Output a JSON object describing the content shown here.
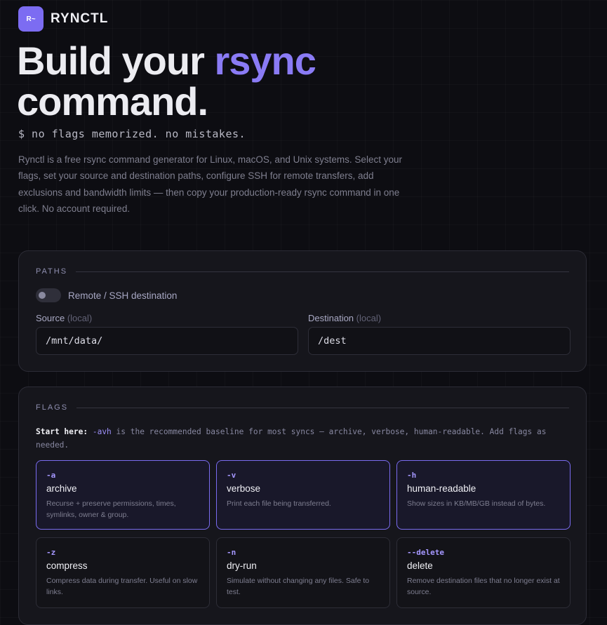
{
  "brand": {
    "logo_text": "R~",
    "name": "RYNCTL"
  },
  "hero": {
    "title_part1": "Build your ",
    "title_accent": "rsync",
    "title_part2": "command.",
    "tagline": "$ no flags memorized. no mistakes.",
    "description": "Rynctl is a free rsync command generator for Linux, macOS, and Unix systems. Select your flags, set your source and destination paths, configure SSH for remote transfers, add exclusions and bandwidth limits — then copy your production-ready rsync command in one click. No account required."
  },
  "paths": {
    "section_label": "PATHS",
    "remote_toggle_label": "Remote / SSH destination",
    "remote_enabled": false,
    "source": {
      "label": "Source",
      "sub": "(local)",
      "value": "/mnt/data/"
    },
    "destination": {
      "label": "Destination",
      "sub": "(local)",
      "value": "/dest"
    }
  },
  "flags": {
    "section_label": "FLAGS",
    "hint_lead": "Start here:",
    "hint_code": "-avh",
    "hint_rest": " is the recommended baseline for most syncs — archive, verbose, human-readable. Add flags as needed.",
    "items": [
      {
        "code": "-a",
        "name": "archive",
        "desc": "Recurse + preserve permissions, times, symlinks, owner & group.",
        "selected": true
      },
      {
        "code": "-v",
        "name": "verbose",
        "desc": "Print each file being transferred.",
        "selected": true
      },
      {
        "code": "-h",
        "name": "human-readable",
        "desc": "Show sizes in KB/MB/GB instead of bytes.",
        "selected": true
      },
      {
        "code": "-z",
        "name": "compress",
        "desc": "Compress data during transfer. Useful on slow links.",
        "selected": false
      },
      {
        "code": "-n",
        "name": "dry-run",
        "desc": "Simulate without changing any files. Safe to test.",
        "selected": false
      },
      {
        "code": "--delete",
        "name": "delete",
        "desc": "Remove destination files that no longer exist at source.",
        "selected": false
      }
    ]
  },
  "colors": {
    "accent": "#8a7bf5",
    "background": "#0d0d12",
    "card": "#16161c"
  }
}
